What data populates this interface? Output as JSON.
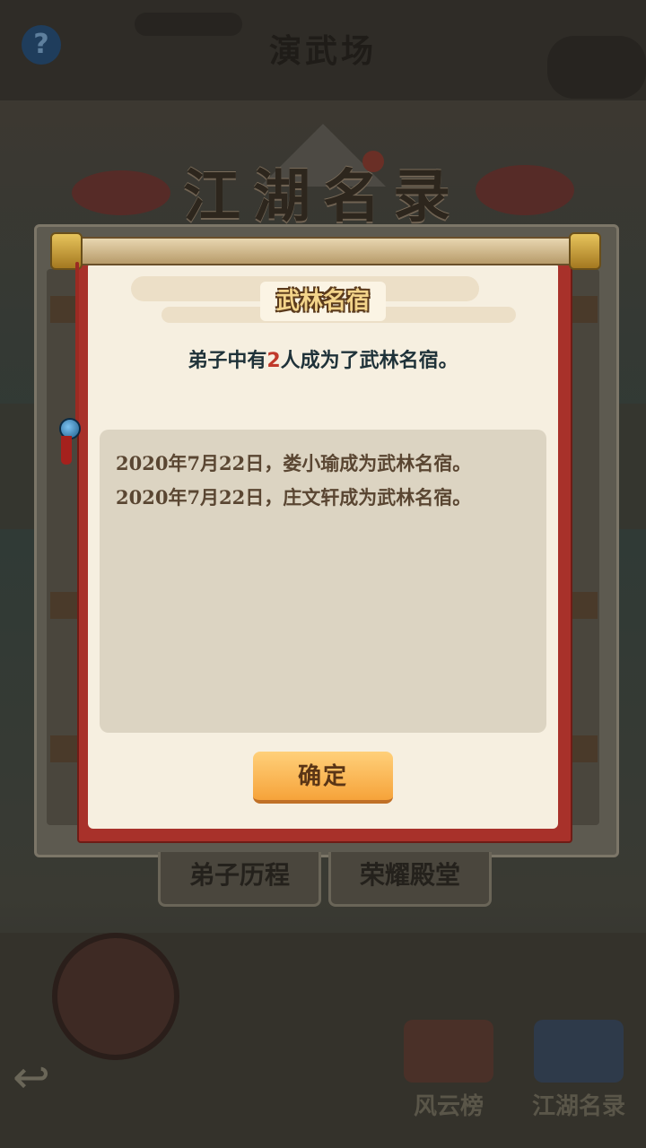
{
  "scene": {
    "help_label": "?",
    "title": "演武场",
    "tabs": [
      "弟子历程",
      "荣耀殿堂"
    ],
    "bottom_nav": [
      {
        "label": "风云榜",
        "icon": "scroll-list-icon"
      },
      {
        "label": "江湖名录",
        "icon": "book-icon"
      }
    ],
    "back_icon": "back-arrow-icon"
  },
  "header": {
    "title": "江湖名录"
  },
  "dialog": {
    "title": "武林名宿",
    "summary_prefix": "弟子中有",
    "summary_count": "2",
    "summary_suffix": "人成为了武林名宿。",
    "entries": [
      "2020年7月22日，娄小瑜成为武林名宿。",
      "2020年7月22日，庄文轩成为武林名宿。"
    ],
    "confirm_label": "确定"
  },
  "colors": {
    "scroll_red": "#a8312a",
    "paper": "#f6efe0",
    "button_orange": "#f6a33a",
    "highlight_number": "#c0392b"
  }
}
